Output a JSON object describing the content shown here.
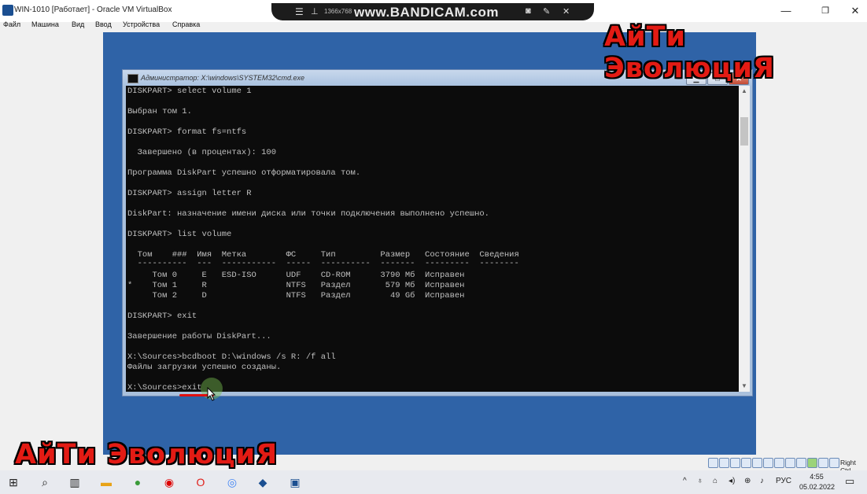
{
  "host_window": {
    "title": "WIN-1010 [Работает] - Oracle VM VirtualBox",
    "minimize": "—",
    "maximize": "❐",
    "close": "✕"
  },
  "recorder_bar": {
    "resolution": "1366x768",
    "watermark": "www.BANDICAM.com"
  },
  "menu": [
    "Файл",
    "Машина",
    "Вид",
    "Ввод",
    "Устройства",
    "Справка"
  ],
  "cmd": {
    "title": "Администратор: X:\\windows\\SYSTEM32\\cmd.exe",
    "min": "▁",
    "max": "□",
    "close": "✕",
    "lines": [
      "DISKPART> select volume 1",
      "",
      "Выбран том 1.",
      "",
      "DISKPART> format fs=ntfs",
      "",
      "  Завершено (в процентах): 100",
      "",
      "Программа DiskPart успешно отформатировала том.",
      "",
      "DISKPART> assign letter R",
      "",
      "DiskPart: назначение имени диска или точки подключения выполнено успешно.",
      "",
      "DISKPART> list volume",
      "",
      "  Том    ###  Имя  Метка        ФС     Тип         Размер   Состояние  Сведения",
      "  ----------  ---  -----------  -----  ----------  -------  ---------  --------",
      "     Том 0     E   ESD-ISO      UDF    CD-ROM      3790 Мб  Исправен",
      "*    Том 1     R                NTFS   Раздел       579 Мб  Исправен",
      "     Том 2     D                NTFS   Раздел        49 Gб  Исправен",
      "",
      "DISKPART> exit",
      "",
      "Завершение работы DiskPart...",
      "",
      "X:\\Sources>bcdboot D:\\windows /s R: /f all",
      "Файлы загрузки успешно созданы.",
      "",
      "X:\\Sources>exit"
    ]
  },
  "watermark_text": "АйТи ЭволюциЯ",
  "vbox_status": {
    "host_key": "Right Ctrl"
  },
  "taskbar": {
    "language": "РУС",
    "time": "4:55",
    "date": "05.02.2022"
  },
  "colors": {
    "vm_background": "#2f63a7",
    "console_bg": "#0c0c0c",
    "console_text": "#c0c0c0",
    "watermark": "#e31b14"
  }
}
